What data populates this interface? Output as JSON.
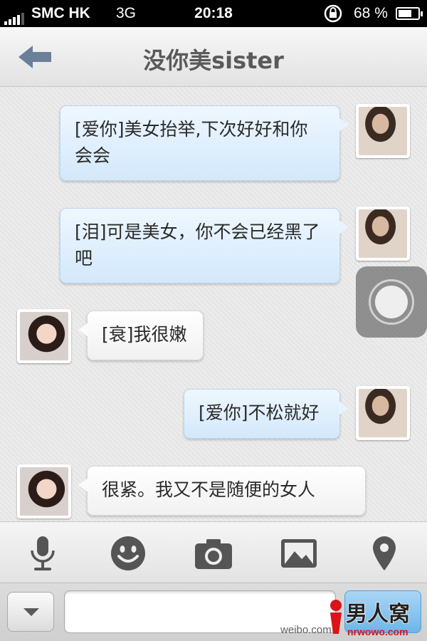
{
  "status_bar": {
    "carrier": "SMC HK",
    "network": "3G",
    "time": "20:18",
    "battery": "68 %",
    "battery_level": 0.68
  },
  "header": {
    "title": "没你美sister",
    "back_icon": "back-arrow-icon"
  },
  "messages": [
    {
      "sender": "me",
      "text": "[爱你]美女抬举,下次好好和你会会"
    },
    {
      "sender": "me",
      "text": "[泪]可是美女，你不会已经黑了吧"
    },
    {
      "sender": "her",
      "text": "[衰]我很嫩"
    },
    {
      "sender": "me",
      "text": "[爱你]不松就好"
    },
    {
      "sender": "her",
      "text": "很紧。我又不是随便的女人"
    }
  ],
  "toolbar": {
    "icons": [
      "microphone-icon",
      "emoji-icon",
      "camera-icon",
      "photo-library-icon",
      "location-pin-icon"
    ]
  },
  "input": {
    "value": "",
    "placeholder": ""
  },
  "watermark": {
    "source": "weibo.com",
    "logo_text": "男人窝",
    "logo_url": "nrwowo.com"
  },
  "colors": {
    "accent": "#3b8fd8",
    "outgoing_bubble": "#d3e8fb",
    "incoming_bubble": "#ffffff"
  }
}
